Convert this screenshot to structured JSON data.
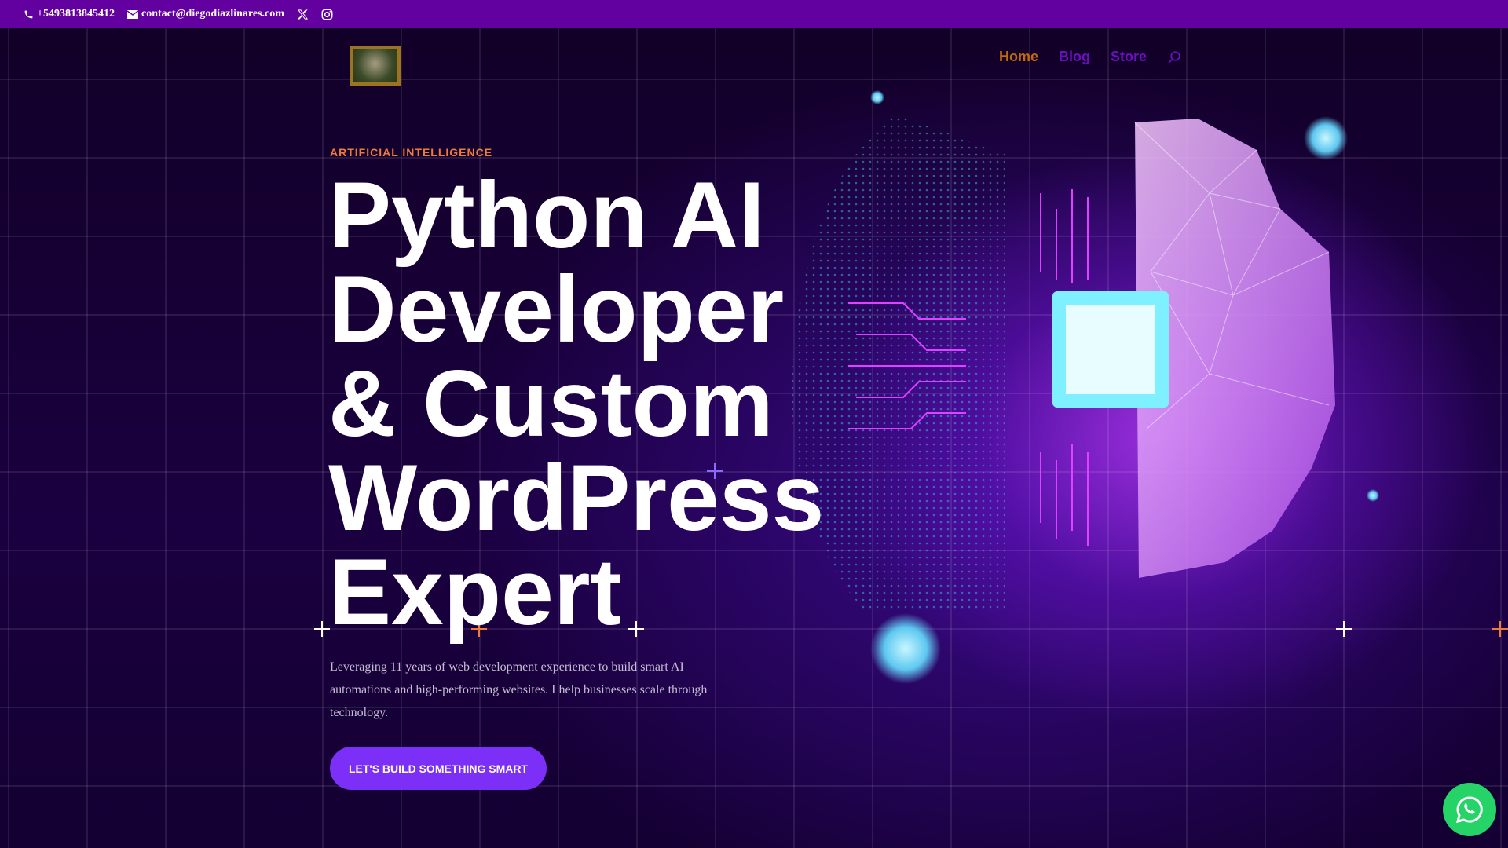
{
  "topbar": {
    "phone": "+5493813845412",
    "email": "contact@diegodiazlinares.com"
  },
  "nav": {
    "items": [
      {
        "label": "Home"
      },
      {
        "label": "Blog"
      },
      {
        "label": "Store"
      }
    ]
  },
  "hero": {
    "eyebrow": "ARTIFICIAL INTELLIGENCE",
    "headline": "Python AI Developer & Custom WordPress Expert",
    "description": "Leveraging 11 years of web development experience to build smart AI automations and high-performing websites. I help businesses scale through technology.",
    "cta": "LET'S BUILD SOMETHING SMART"
  },
  "colors": {
    "topbar": "#6300a0",
    "accent": "#7b2ff7",
    "eyebrow": "#f07a3c",
    "nav_active": "#c06a10",
    "nav": "#6a10c0",
    "whatsapp": "#25d366"
  }
}
